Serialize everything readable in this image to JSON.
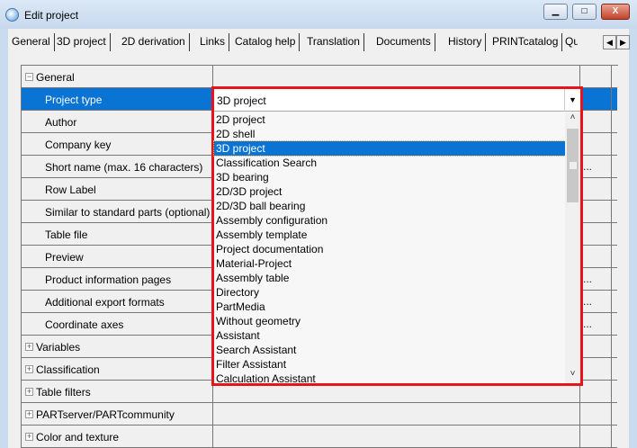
{
  "window": {
    "title": "Edit project",
    "minimize": "▁",
    "maximize": "□",
    "close": "X"
  },
  "tabs": [
    "General",
    "3D project",
    "2D derivation",
    "Links",
    "Catalog help",
    "Translation",
    "Documents",
    "History",
    "PRINTcatalog",
    "Qu"
  ],
  "tab_scroll": {
    "left": "◀",
    "right": "▶"
  },
  "grid": {
    "rows": [
      {
        "label": "General",
        "type": "group",
        "expanded": true,
        "toggle": "−"
      },
      {
        "label": "Project type",
        "selected": true
      },
      {
        "label": "Author"
      },
      {
        "label": "Company key"
      },
      {
        "label": "Short name (max. 16 characters)",
        "ellipsis": "..."
      },
      {
        "label": "Row Label"
      },
      {
        "label": "Similar to standard parts (optional)"
      },
      {
        "label": "Table file"
      },
      {
        "label": "Preview"
      },
      {
        "label": "Product information pages",
        "ellipsis": "..."
      },
      {
        "label": "Additional export formats",
        "ellipsis": "..."
      },
      {
        "label": "Coordinate axes",
        "ellipsis": "..."
      },
      {
        "label": "Variables",
        "type": "group",
        "toggle": "+"
      },
      {
        "label": "Classification",
        "type": "group",
        "toggle": "+"
      },
      {
        "label": "Table filters",
        "type": "group",
        "toggle": "+"
      },
      {
        "label": "PARTserver/PARTcommunity",
        "type": "group",
        "toggle": "+"
      },
      {
        "label": "Color and texture",
        "type": "group",
        "toggle": "+"
      }
    ]
  },
  "dropdown": {
    "value": "3D project",
    "arrow": "▼",
    "options": [
      "2D project",
      "2D shell",
      "3D project",
      "Classification Search",
      "3D bearing",
      "2D/3D project",
      "2D/3D ball bearing",
      "Assembly configuration",
      "Assembly template",
      "Project documentation",
      "Material-Project",
      "Assembly table",
      "Directory",
      "PartMedia",
      "Without geometry",
      "Assistant",
      "Search Assistant",
      "Filter Assistant",
      "Calculation Assistant"
    ],
    "selected_index": 2,
    "scroll_up": "˄",
    "scroll_down": "˅",
    "highlight_color": "#e8141c"
  }
}
